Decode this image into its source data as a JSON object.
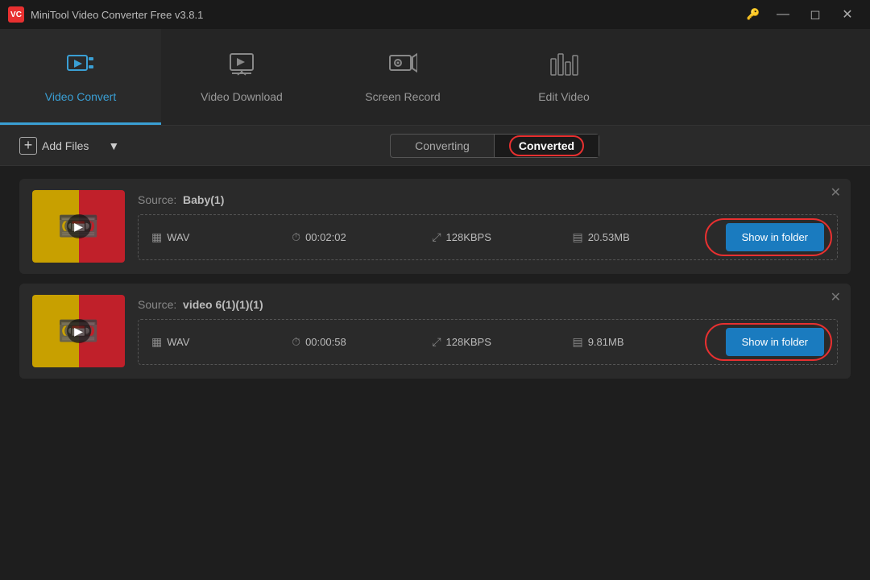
{
  "app": {
    "title": "MiniTool Video Converter Free v3.8.1",
    "icon_label": "VC"
  },
  "titlebar": {
    "key_icon": "🔑",
    "minimize_icon": "—",
    "restore_icon": "❐",
    "close_icon": "✕"
  },
  "nav": {
    "items": [
      {
        "id": "video-convert",
        "label": "Video Convert",
        "icon": "📼",
        "active": true
      },
      {
        "id": "video-download",
        "label": "Video Download",
        "icon": "⬇"
      },
      {
        "id": "screen-record",
        "label": "Screen Record",
        "icon": "📹"
      },
      {
        "id": "edit-video",
        "label": "Edit Video",
        "icon": "✂"
      }
    ]
  },
  "toolbar": {
    "add_files_label": "Add Files",
    "tabs": [
      {
        "id": "converting",
        "label": "Converting",
        "active": false
      },
      {
        "id": "converted",
        "label": "Converted",
        "active": true
      }
    ]
  },
  "files": [
    {
      "id": "file1",
      "source_label": "Source:",
      "source_name": "Baby(1)",
      "format": "WAV",
      "duration": "00:02:02",
      "bitrate": "128KBPS",
      "size": "20.53MB",
      "show_folder_label": "Show in folder"
    },
    {
      "id": "file2",
      "source_label": "Source:",
      "source_name": "video 6(1)(1)(1)",
      "format": "WAV",
      "duration": "00:00:58",
      "bitrate": "128KBPS",
      "size": "9.81MB",
      "show_folder_label": "Show in folder"
    }
  ]
}
